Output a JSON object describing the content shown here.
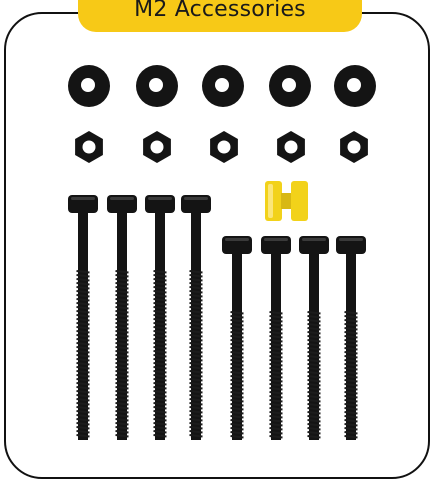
{
  "title": "M2 Accessories",
  "colors": {
    "accent": "#f7c917",
    "part_black": "#141414",
    "spacer_yellow": "#f2d21a",
    "outline": "#111111"
  },
  "parts": {
    "washers": 5,
    "nuts": 5,
    "long_screws": 4,
    "short_screws": 4,
    "spacers": 1
  },
  "icons": [
    "washer-icon",
    "hex-nut-icon",
    "screw-icon",
    "spacer-icon"
  ]
}
